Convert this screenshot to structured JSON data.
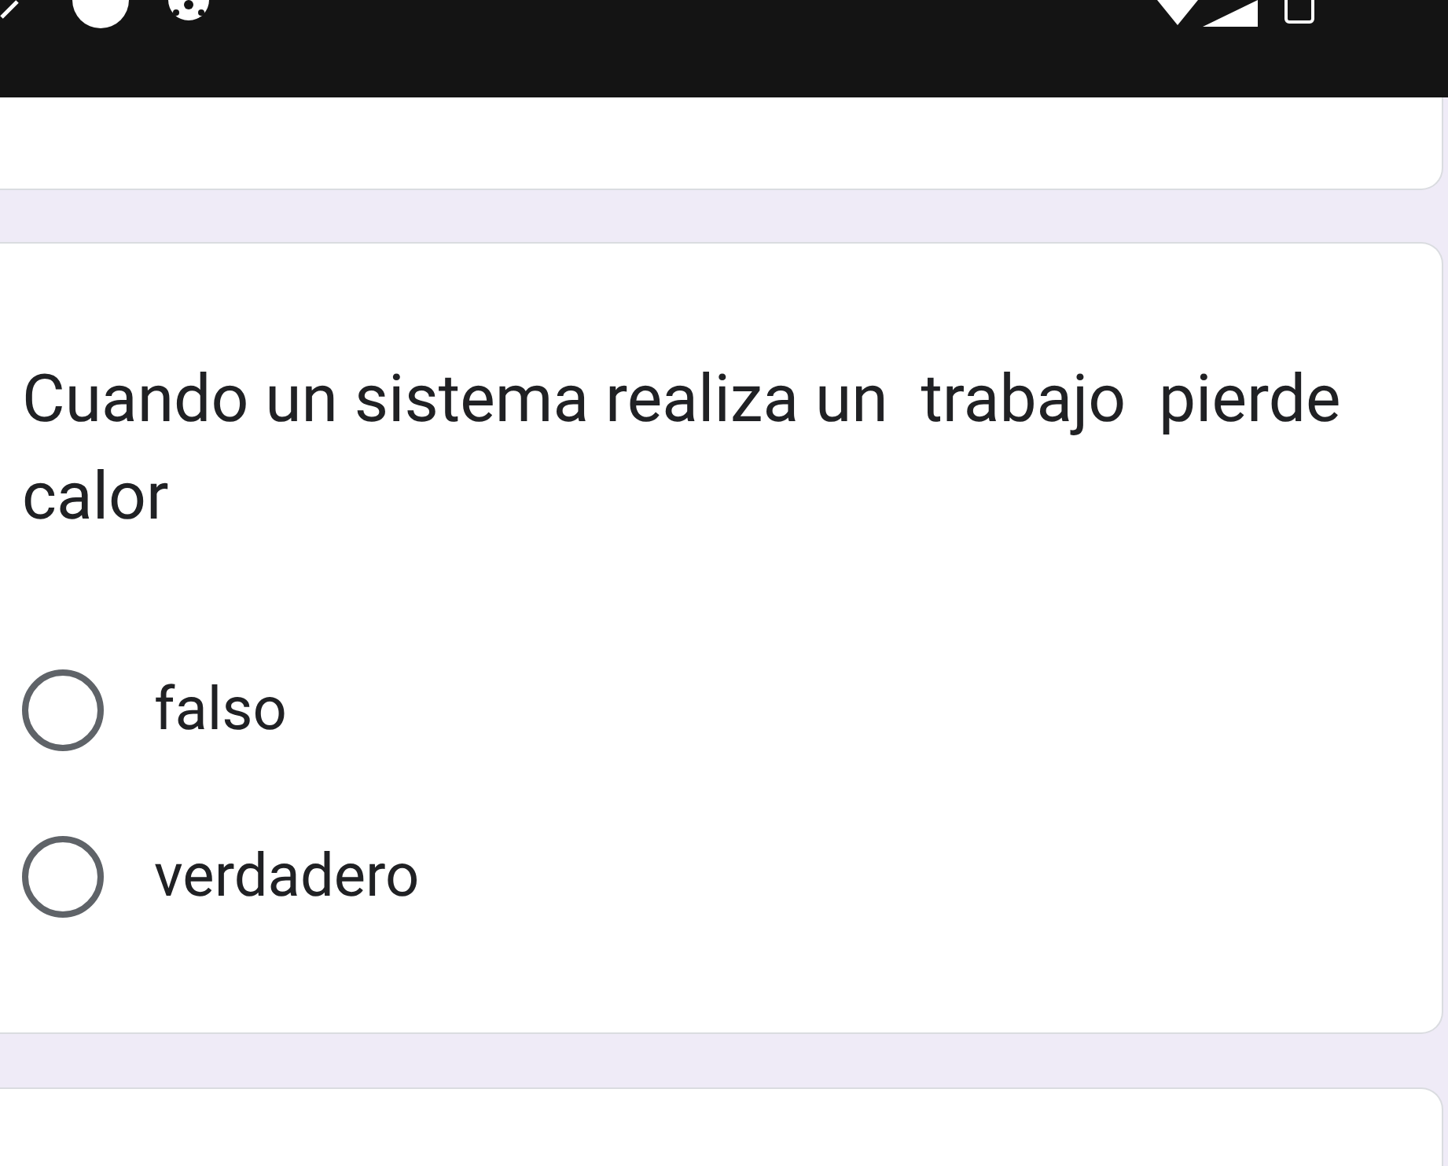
{
  "question": {
    "title": "Cuando un sistema realiza un  trabajo  pierde calor",
    "options": [
      {
        "label": "falso",
        "selected": false
      },
      {
        "label": "verdadero",
        "selected": false
      }
    ]
  }
}
